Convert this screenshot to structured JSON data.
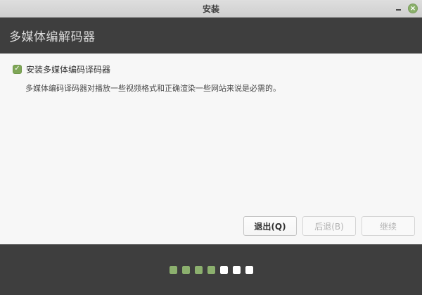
{
  "window": {
    "title": "安装"
  },
  "icons": {
    "minimize": "–",
    "close": "✕",
    "check": "✓"
  },
  "header": {
    "title": "多媒体编解码器"
  },
  "content": {
    "checkbox": {
      "checked": true,
      "label": "安装多媒体编码译码器"
    },
    "description": "多媒体编码译码器对播放一些视频格式和正确渲染一些网站来说是必需的。"
  },
  "buttons": {
    "quit_label": "退出(Q)",
    "quit_enabled": true,
    "back_label": "后退(B)",
    "back_enabled": false,
    "continue_label": "继续",
    "continue_enabled": false
  },
  "footer": {
    "progress_dots": [
      "done",
      "done",
      "done",
      "done",
      "todo",
      "todo",
      "todo"
    ]
  },
  "colors": {
    "green": "#8ab06a",
    "checkbox_green": "#7fa657",
    "header_bg": "#3e3e3e",
    "footer_bg": "#3e3e3e",
    "content_bg": "#f7f7f7",
    "dot_done": "#8cb06e",
    "dot_todo": "#ffffff"
  }
}
